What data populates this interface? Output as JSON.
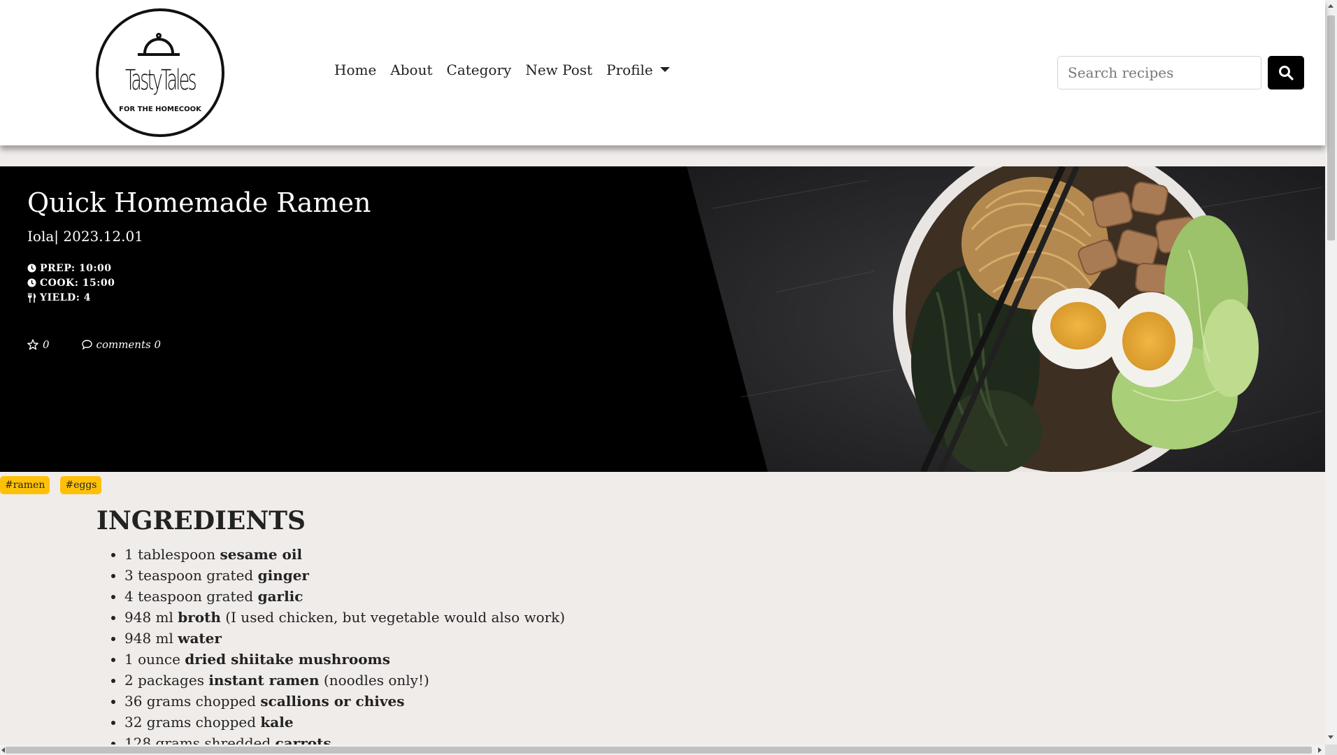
{
  "brand": {
    "logo_name": "TastyTales",
    "logo_tagline": "FOR THE HOMECOOK"
  },
  "nav": {
    "items": [
      "Home",
      "About",
      "Category",
      "New Post",
      "Profile"
    ]
  },
  "search": {
    "placeholder": "Search recipes"
  },
  "recipe": {
    "title": "Quick Homemade Ramen",
    "author": "Iola",
    "date": "2023.12.01",
    "prep": "PREP: 10:00",
    "cook": "COOK: 15:00",
    "yield": "YIELD: 4",
    "likes": "0",
    "comments": "comments 0"
  },
  "tags": [
    "#ramen",
    "#eggs"
  ],
  "ingredients": {
    "heading": "INGREDIENTS",
    "items": [
      {
        "pre": "1 tablespoon ",
        "bold": "sesame oil",
        "post": ""
      },
      {
        "pre": "3 teaspoon grated ",
        "bold": "ginger",
        "post": ""
      },
      {
        "pre": "4 teaspoon grated ",
        "bold": "garlic",
        "post": ""
      },
      {
        "pre": "948 ml ",
        "bold": "broth",
        "post": " (I used chicken, but vegetable would also work)"
      },
      {
        "pre": "948 ml ",
        "bold": "water",
        "post": ""
      },
      {
        "pre": "1 ounce ",
        "bold": "dried shiitake mushrooms",
        "post": ""
      },
      {
        "pre": "2 packages ",
        "bold": "instant ramen",
        "post": " (noodles only!)"
      },
      {
        "pre": "36 grams chopped ",
        "bold": "scallions or chives",
        "post": ""
      },
      {
        "pre": "32 grams chopped ",
        "bold": "kale",
        "post": ""
      },
      {
        "pre": "128 grams shredded ",
        "bold": "carrots",
        "post": ""
      }
    ]
  },
  "colors": {
    "hero_background": "#000000",
    "tag_background": "#ffc107",
    "page_background": "#f0ecea",
    "search_button": "#000000"
  },
  "icons": {
    "search": "search-icon",
    "prep": "clock-icon",
    "cook": "clock-icon",
    "yield": "utensils-icon",
    "likes": "star-outline-icon",
    "comments": "comment-bubble-icon"
  }
}
